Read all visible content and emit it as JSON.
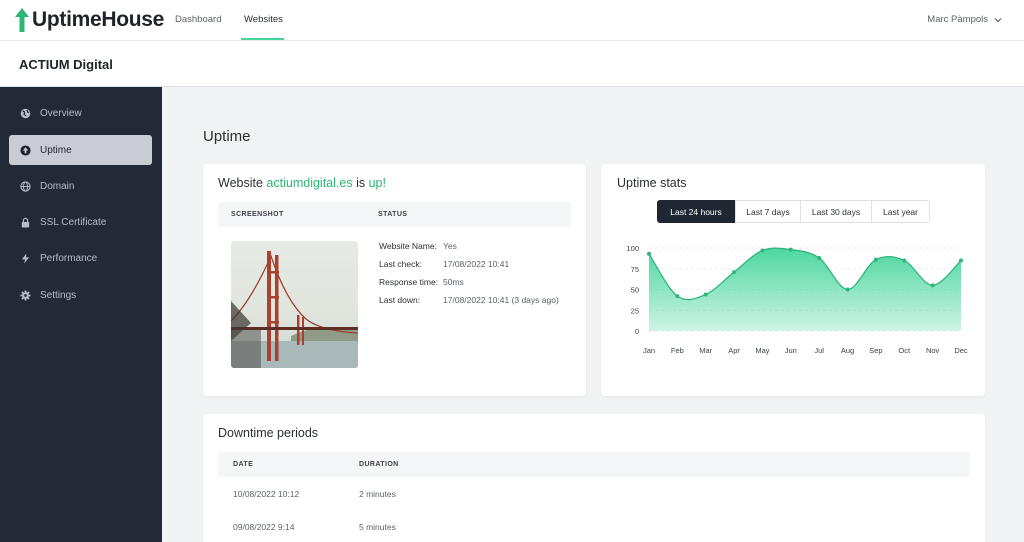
{
  "brand": {
    "name": "UptimeHouse",
    "accent": "#43d49a"
  },
  "topnav": {
    "links": [
      {
        "label": "Dashboard",
        "active": false
      },
      {
        "label": "Websites",
        "active": true
      }
    ],
    "user": "Marc Pàmpols"
  },
  "site": {
    "name": "ACTIUM Digital"
  },
  "sidebar": {
    "items": [
      {
        "label": "Overview",
        "icon": "globe-icon",
        "active": false
      },
      {
        "label": "Uptime",
        "icon": "arrow-up-circle-icon",
        "active": true
      },
      {
        "label": "Domain",
        "icon": "globe-icon",
        "active": false
      },
      {
        "label": "SSL Certificate",
        "icon": "lock-icon",
        "active": false
      },
      {
        "label": "Performance",
        "icon": "bolt-icon",
        "active": false
      },
      {
        "label": "Settings",
        "icon": "gear-icon",
        "active": false
      }
    ]
  },
  "page": {
    "title": "Uptime"
  },
  "status_card": {
    "title_prefix": "Website",
    "domain": "actiumdigital.es",
    "title_mid": "is",
    "state": "up!",
    "col_screenshot": "SCREENSHOT",
    "col_status": "STATUS",
    "rows": [
      {
        "label": "Website Name:",
        "value": "Yes"
      },
      {
        "label": "Last check:",
        "value": "17/08/2022 10:41"
      },
      {
        "label": "Response time:",
        "value": "50ms"
      },
      {
        "label": "Last down:",
        "value": "17/08/2022 10:41 (3 days ago)"
      }
    ]
  },
  "stats_card": {
    "title": "Uptime stats",
    "ranges": [
      {
        "label": "Last 24 hours",
        "active": true
      },
      {
        "label": "Last 7 days",
        "active": false
      },
      {
        "label": "Last 30 days",
        "active": false
      },
      {
        "label": "Last year",
        "active": false
      }
    ]
  },
  "chart_data": {
    "type": "area",
    "categories": [
      "Jan",
      "Feb",
      "Mar",
      "Apr",
      "May",
      "Jun",
      "Jul",
      "Aug",
      "Sep",
      "Oct",
      "Nov",
      "Dec"
    ],
    "series": [
      {
        "values": [
          93,
          42,
          44,
          71,
          97,
          98,
          88,
          50,
          86,
          85,
          55,
          85
        ]
      }
    ],
    "yticks": [
      0,
      25,
      50,
      75,
      100
    ],
    "ylim": [
      0,
      100
    ],
    "grid": "horizontal dashed",
    "color": "#43d49a"
  },
  "downtime_card": {
    "title": "Downtime periods",
    "columns": [
      "DATE",
      "DURATION"
    ],
    "rows": [
      {
        "date": "10/08/2022 10:12",
        "duration": "2 minutes"
      },
      {
        "date": "09/08/2022 9:14",
        "duration": "5 minutes"
      }
    ]
  }
}
